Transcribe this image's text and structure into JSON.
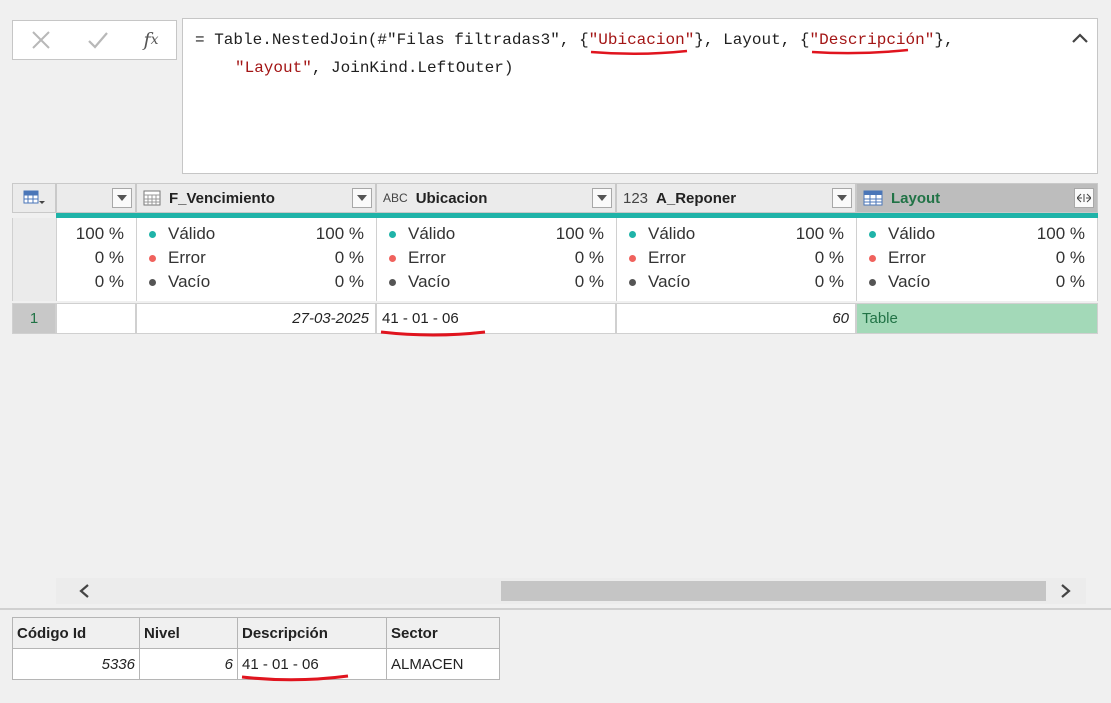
{
  "formula": {
    "line1_prefix": "= Table.NestedJoin(#\"Filas filtradas3\", {",
    "line1_key": "\"Ubicacion\"",
    "line1_mid": "}, Layout, {",
    "line1_key2": "\"Descripción\"",
    "line1_suffix": "},",
    "line2_str": "\"Layout\"",
    "line2_rest": ", JoinKind.LeftOuter)"
  },
  "grid": {
    "columns": [
      {
        "name": ""
      },
      {
        "name": "F_Vencimiento",
        "type": "date"
      },
      {
        "name": "Ubicacion",
        "type": "text",
        "type_label": "ABC"
      },
      {
        "name": "A_Reponer",
        "type": "number",
        "type_label": "123"
      },
      {
        "name": "Layout",
        "type": "table"
      }
    ],
    "quality": {
      "labels": [
        "Válido",
        "Error",
        "Vacío"
      ],
      "first_col": [
        "100 %",
        "0 %",
        "0 %"
      ],
      "pcts": [
        "100 %",
        "0 %",
        "0 %"
      ]
    },
    "row": {
      "index": "1",
      "c0": "",
      "f_vencimiento": "27-03-2025",
      "ubicacion": "41 - 01 - 06",
      "a_reponer": "60",
      "layout": "Table"
    }
  },
  "colors": {
    "valid": "#1fb3a8",
    "error": "#f0625d",
    "empty": "#555555",
    "layout_cell": "#a3d9b8"
  },
  "bottom_table": {
    "headers": [
      "Código Id",
      "Nivel",
      "Descripción",
      "Sector"
    ],
    "row": [
      "5336",
      "6",
      "41 - 01 - 06",
      "ALMACEN"
    ]
  }
}
